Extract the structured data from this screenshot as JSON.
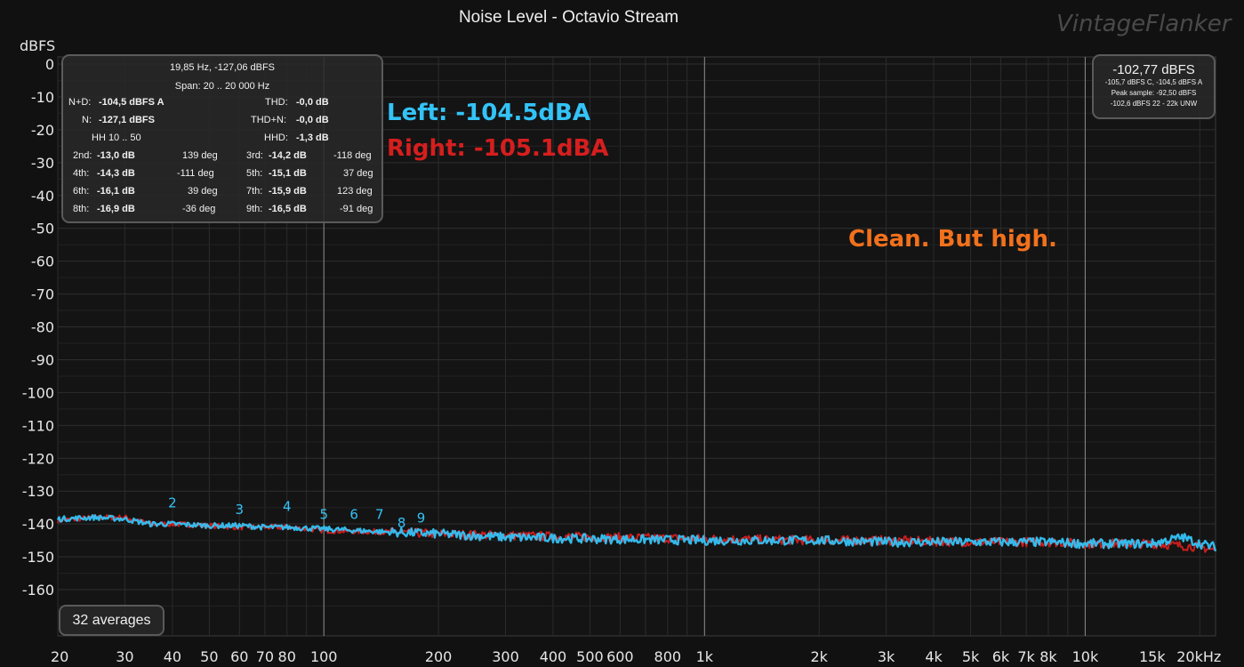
{
  "chart_data": {
    "type": "line",
    "title": "Noise Level - Octavio Stream",
    "watermark": "VintageFlanker",
    "ylabel": "dBFS",
    "xlabel": "",
    "xscale": "log",
    "xlim": [
      20,
      22000
    ],
    "ylim": [
      -170,
      0
    ],
    "grid": true,
    "y_ticks": [
      0,
      -10,
      -20,
      -30,
      -40,
      -50,
      -60,
      -70,
      -80,
      -90,
      -100,
      -110,
      -120,
      -130,
      -140,
      -150,
      -160
    ],
    "y_tick_labels": [
      "0",
      "-10",
      "-20",
      "-30",
      "-40",
      "-50",
      "-60",
      "-70",
      "-80",
      "-90",
      "-100",
      "-110",
      "-120",
      "-130",
      "-140",
      "-150",
      "-160"
    ],
    "x_ticks": [
      20,
      30,
      40,
      50,
      60,
      70,
      80,
      100,
      200,
      300,
      400,
      500,
      600,
      800,
      1000,
      2000,
      3000,
      4000,
      5000,
      6000,
      7000,
      8000,
      10000,
      15000,
      20000
    ],
    "x_tick_labels": [
      "20",
      "30",
      "40",
      "50",
      "60",
      "70",
      "80",
      "100",
      "200",
      "300",
      "400",
      "500",
      "600",
      "800",
      "1k",
      "2k",
      "3k",
      "4k",
      "5k",
      "6k",
      "7k",
      "8k",
      "10k",
      "15k",
      "20kHz"
    ],
    "series": [
      {
        "color": "#d61e1e",
        "x": [
          20,
          25,
          30,
          35,
          40,
          50,
          60,
          70,
          80,
          100,
          150,
          200,
          300,
          500,
          1000,
          2000,
          3000,
          5000,
          8000,
          10000,
          12000,
          15000,
          20000,
          22000
        ],
        "y": [
          -139,
          -138,
          -138,
          -140,
          -140,
          -140.5,
          -141,
          -141,
          -141,
          -142,
          -142.5,
          -143,
          -143.5,
          -144,
          -144.5,
          -145,
          -145,
          -145.5,
          -145.5,
          -146,
          -146,
          -146,
          -147,
          -148
        ]
      },
      {
        "color": "#33c3f7",
        "x": [
          20,
          25,
          30,
          35,
          40,
          50,
          60,
          70,
          80,
          100,
          150,
          200,
          300,
          500,
          1000,
          2000,
          3000,
          5000,
          8000,
          10000,
          12000,
          15000,
          18000,
          20000,
          22000
        ],
        "y": [
          -138.5,
          -138,
          -138.5,
          -140,
          -140,
          -140.5,
          -140.5,
          -141,
          -141,
          -141.5,
          -142.5,
          -143,
          -144,
          -144.5,
          -145,
          -145,
          -145.5,
          -145.5,
          -145.5,
          -146,
          -146,
          -146,
          -144,
          -146,
          -147
        ]
      }
    ],
    "harmonic_markers": [
      {
        "label": "2",
        "x": 40,
        "y": -135
      },
      {
        "label": "3",
        "x": 60,
        "y": -137
      },
      {
        "label": "4",
        "x": 80,
        "y": -136
      },
      {
        "label": "5",
        "x": 100,
        "y": -138.5
      },
      {
        "label": "6",
        "x": 120,
        "y": -138.5
      },
      {
        "label": "7",
        "x": 140,
        "y": -138.5
      },
      {
        "label": "8",
        "x": 160,
        "y": -141
      },
      {
        "label": "9",
        "x": 180,
        "y": -139.5
      }
    ]
  },
  "stats": {
    "cursor": "19,85 Hz, -127,06 dBFS",
    "span": "Span: 20 .. 20 000 Hz",
    "nd_label": "N+D:",
    "nd_value": "-104,5 dBFS A",
    "thd_label": "THD:",
    "thd_value": "-0,0 dB",
    "n_label": "N:",
    "n_value": "-127,1 dBFS",
    "thdn_label": "THD+N:",
    "thdn_value": "-0,0 dB",
    "hh": "HH 10 .. 50",
    "hhd_label": "HHD:",
    "hhd_value": "-1,3 dB",
    "h2_label": "2nd:",
    "h2_value": "-13,0 dB",
    "h2_deg": "139 deg",
    "h3_label": "3rd:",
    "h3_value": "-14,2 dB",
    "h3_deg": "-118 deg",
    "h4_label": "4th:",
    "h4_value": "-14,3 dB",
    "h4_deg": "-111 deg",
    "h5_label": "5th:",
    "h5_value": "-15,1 dB",
    "h5_deg": "37 deg",
    "h6_label": "6th:",
    "h6_value": "-16,1 dB",
    "h6_deg": "39 deg",
    "h7_label": "7th:",
    "h7_value": "-15,9 dB",
    "h7_deg": "123 deg",
    "h8_label": "8th:",
    "h8_value": "-16,9 dB",
    "h8_deg": "-36 deg",
    "h9_label": "9th:",
    "h9_value": "-16,5 dB",
    "h9_deg": "-91 deg"
  },
  "level": {
    "main": "-102,77 dBFS",
    "line1": "-105,7 dBFS C, -104,5 dBFS A",
    "line2": "Peak sample: -92,50 dBFS",
    "line3": "-102,6 dBFS 22 - 22k UNW"
  },
  "averages": "32 averages",
  "annotations": {
    "left": "Left: -104.5dBA",
    "right": "Right: -105.1dBA",
    "comment": "Clean. But high."
  }
}
